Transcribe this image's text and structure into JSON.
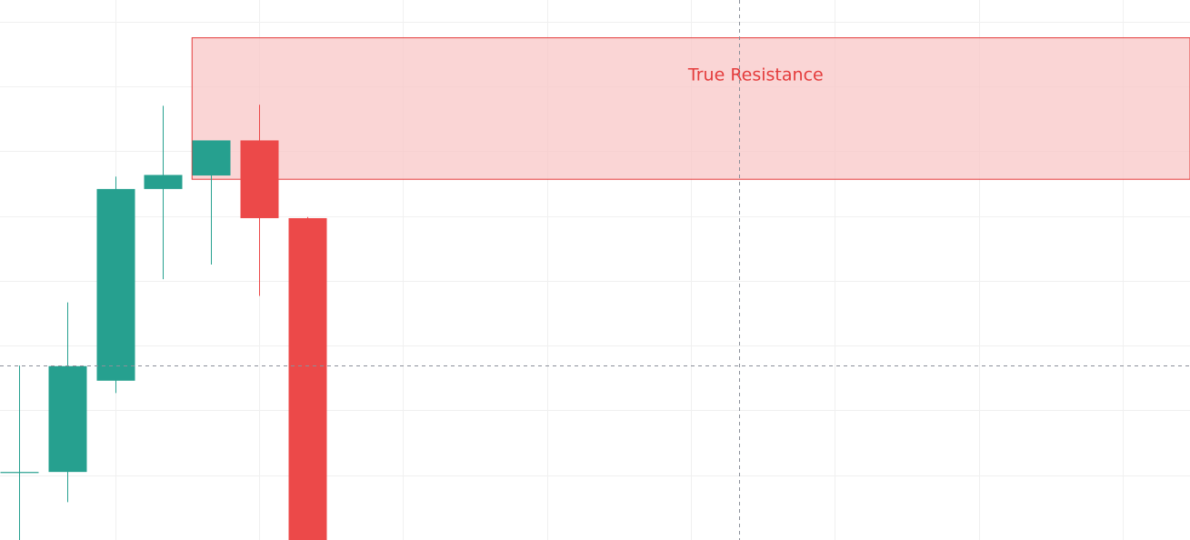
{
  "colors": {
    "background": "#ffffff",
    "grid": "#f0f0f0",
    "up": "#26a08f",
    "down": "#ec4949",
    "zone_fill": "#f8c3c3",
    "zone_border": "#e43c3c",
    "zone_text": "#e43c3c",
    "crosshair": "#8a8f99"
  },
  "chart_data": {
    "type": "candlestick",
    "title": "",
    "xlabel": "",
    "ylabel": "",
    "grid": true,
    "legend": "none",
    "axes_labels_visible": false,
    "x_range": [
      -0.4,
      24.4
    ],
    "y_range": [
      0,
      100
    ],
    "candles": [
      {
        "i": 0,
        "open": 12.4,
        "high": 32.3,
        "low": 0.0,
        "close": 12.6
      },
      {
        "i": 1,
        "open": 12.6,
        "high": 44.0,
        "low": 7.0,
        "close": 32.2
      },
      {
        "i": 2,
        "open": 29.5,
        "high": 67.3,
        "low": 27.2,
        "close": 65.0
      },
      {
        "i": 3,
        "open": 65.0,
        "high": 80.4,
        "low": 48.3,
        "close": 67.6
      },
      {
        "i": 4,
        "open": 67.5,
        "high": 70.5,
        "low": 51.0,
        "close": 74.0
      },
      {
        "i": 5,
        "open": 74.0,
        "high": 80.6,
        "low": 45.2,
        "close": 59.6
      },
      {
        "i": 6,
        "open": 59.6,
        "high": 59.8,
        "low": 0.0,
        "close": 0.0
      }
    ],
    "zones": [
      {
        "label": "True Resistance",
        "from_index": 4,
        "low": 66.8,
        "high": 93.0
      }
    ],
    "crosshair": {
      "index": 15.0,
      "price": 32.3
    }
  }
}
